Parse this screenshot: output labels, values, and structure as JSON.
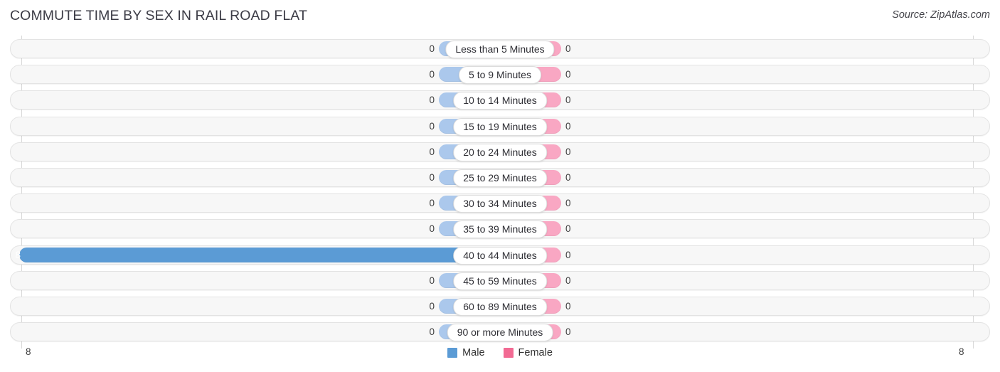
{
  "header": {
    "title": "COMMUTE TIME BY SEX IN RAIL ROAD FLAT",
    "source": "Source: ZipAtlas.com"
  },
  "axis": {
    "left_end": "8",
    "right_end": "8"
  },
  "legend": {
    "items": [
      {
        "label": "Male",
        "color": "#5b9bd5"
      },
      {
        "label": "Female",
        "color": "#f26a93"
      }
    ]
  },
  "colors": {
    "male_zero": "#abc8ec",
    "male_filled": "#5b9bd5",
    "female_zero": "#f9a7c3",
    "female_filled": "#ee5f8e",
    "track": "#f7f7f7",
    "track_border": "#e3e3e3",
    "gridline": "#d8d8d8"
  },
  "chart_data": {
    "type": "bar",
    "title": "COMMUTE TIME BY SEX IN RAIL ROAD FLAT",
    "subtitle": "Source: ZipAtlas.com",
    "orientation": "horizontal",
    "layout": "diverging-bidirectional",
    "xlabel": "",
    "ylabel": "",
    "xlim": [
      8,
      8
    ],
    "axis_tick_labels": [
      "8",
      "8"
    ],
    "grid": true,
    "legend_position": "bottom-center",
    "categories": [
      "Less than 5 Minutes",
      "5 to 9 Minutes",
      "10 to 14 Minutes",
      "15 to 19 Minutes",
      "20 to 24 Minutes",
      "25 to 29 Minutes",
      "30 to 34 Minutes",
      "35 to 39 Minutes",
      "40 to 44 Minutes",
      "45 to 59 Minutes",
      "60 to 89 Minutes",
      "90 or more Minutes"
    ],
    "series": [
      {
        "name": "Male",
        "color": "#5b9bd5",
        "direction": "left",
        "values": [
          0,
          0,
          0,
          0,
          0,
          0,
          0,
          0,
          8,
          0,
          0,
          0
        ]
      },
      {
        "name": "Female",
        "color": "#f26a93",
        "direction": "right",
        "values": [
          0,
          0,
          0,
          0,
          0,
          0,
          0,
          0,
          0,
          0,
          0,
          0
        ]
      }
    ]
  }
}
